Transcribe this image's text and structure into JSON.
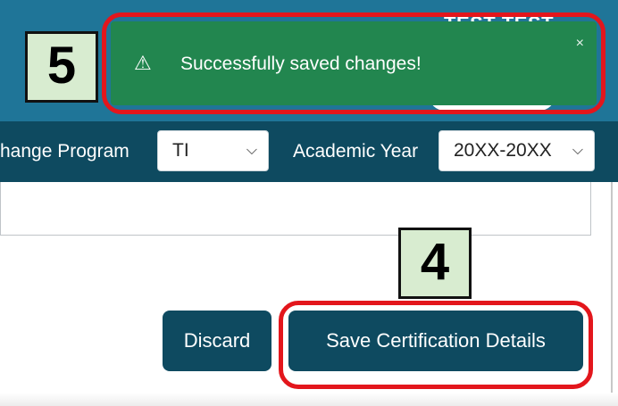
{
  "header": {
    "user_name": "TEST TEST"
  },
  "program_bar": {
    "change_program_label": "hange Program",
    "program_value": "TI",
    "academic_year_label": "Academic Year",
    "year_value": "20XX-20XX"
  },
  "actions": {
    "discard_label": "Discard",
    "save_label": "Save Certification Details"
  },
  "toast": {
    "message": "Successfully saved changes!",
    "close": "×"
  },
  "callouts": {
    "step_5": "5",
    "step_4": "4"
  },
  "colors": {
    "header": "#1f7598",
    "program_bar": "#0e4a60",
    "button": "#0e4a60",
    "toast": "#22864f",
    "callout_fill": "#d8ecd0",
    "highlight": "#e3161c"
  },
  "icons": {
    "toast": "warning-triangle-icon",
    "select": "chevron-down-icon"
  }
}
